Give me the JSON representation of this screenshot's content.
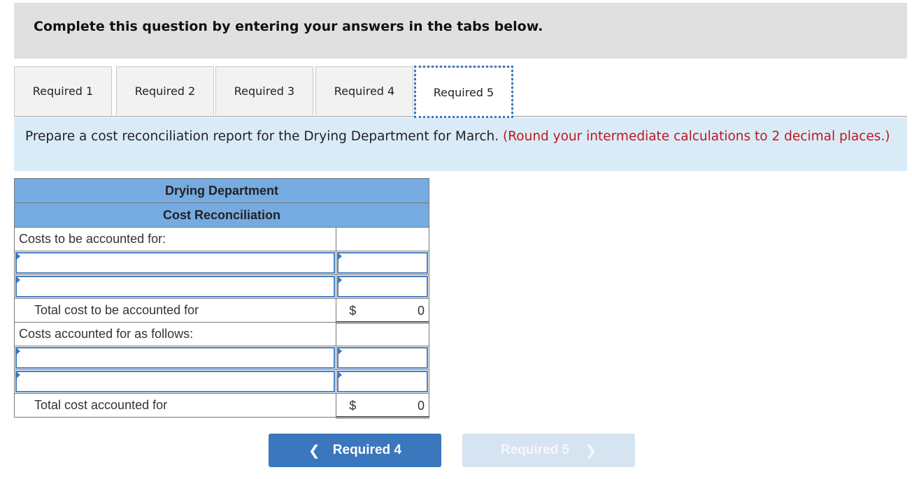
{
  "instruction": "Complete this question by entering your answers in the tabs below.",
  "tabs": [
    {
      "label": "Required 1",
      "active": false
    },
    {
      "label": "Required 2",
      "active": false
    },
    {
      "label": "Required 3",
      "active": false
    },
    {
      "label": "Required 4",
      "active": false
    },
    {
      "label": "Required 5",
      "active": true
    }
  ],
  "prompt": {
    "text": "Prepare a cost reconciliation report for the Drying Department for March.",
    "note": "(Round your intermediate calculations to 2 decimal places.)"
  },
  "report": {
    "title": "Drying Department",
    "subtitle": "Cost Reconciliation",
    "section1_label": "Costs to be accounted for:",
    "section1_inputs": [
      {
        "label_value": "",
        "amount_value": ""
      },
      {
        "label_value": "",
        "amount_value": ""
      }
    ],
    "total1_label": "Total cost to be accounted for",
    "total1_currency": "$",
    "total1_value": "0",
    "section2_label": "Costs accounted for as follows:",
    "section2_inputs": [
      {
        "label_value": "",
        "amount_value": ""
      },
      {
        "label_value": "",
        "amount_value": ""
      }
    ],
    "total2_label": "Total cost accounted for",
    "total2_currency": "$",
    "total2_value": "0"
  },
  "navigation": {
    "prev_label": "Required 4",
    "prev_icon": "chevron-left-icon",
    "next_label": "Required 5",
    "next_icon": "chevron-right-icon",
    "next_disabled": true
  },
  "colors": {
    "header_blue": "#76abe2",
    "prompt_bg": "#daebf8",
    "note_red": "#c0161c",
    "button_blue": "#3a77bc",
    "button_disabled": "#d6e3f1"
  }
}
